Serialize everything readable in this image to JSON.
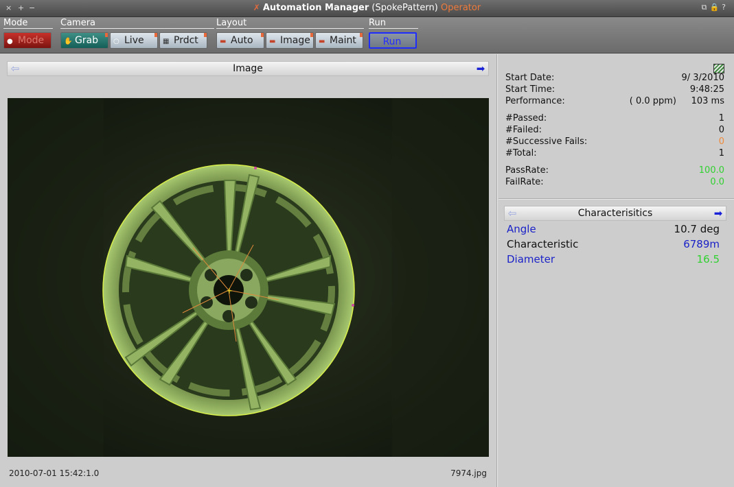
{
  "window": {
    "controls": [
      "×",
      "+",
      "−"
    ],
    "title_app": "Automation Manager",
    "title_project": "(SpokePattern)",
    "title_role": "Operator",
    "title_right_icons": [
      "⧉",
      "🔒",
      "?"
    ]
  },
  "toolbar": {
    "mode": {
      "label": "Mode",
      "buttons": [
        {
          "label": "Mode",
          "icon": "record-icon"
        }
      ]
    },
    "camera": {
      "label": "Camera",
      "buttons": [
        {
          "label": "Grab",
          "icon": "hand-icon"
        },
        {
          "label": "Live",
          "icon": "circle-icon"
        },
        {
          "label": "Prdct",
          "icon": "product-icon"
        }
      ]
    },
    "layout": {
      "label": "Layout",
      "buttons": [
        {
          "label": "Auto",
          "icon": "layout-icon"
        },
        {
          "label": "Image",
          "icon": "layout-icon"
        },
        {
          "label": "Maint",
          "icon": "layout-icon"
        }
      ]
    },
    "run": {
      "label": "Run",
      "buttons": [
        {
          "label": "Run"
        }
      ]
    }
  },
  "image_panel": {
    "title": "Image",
    "timestamp": "2010-07-01 15:42:1.0",
    "filename": "7974.jpg"
  },
  "stats": {
    "start_date_label": "Start Date:",
    "start_date": "9/ 3/2010",
    "start_time_label": "Start Time:",
    "start_time": "9:48:25",
    "performance_label": "Performance:",
    "performance_ppm": "(  0.0 ppm)",
    "performance_ms": "103 ms",
    "passed_label": "#Passed:",
    "passed": "1",
    "failed_label": "#Failed:",
    "failed": "0",
    "successive_label": "#Successive Fails:",
    "successive": "0",
    "total_label": "#Total:",
    "total": "1",
    "passrate_label": "PassRate:",
    "passrate": "100.0",
    "failrate_label": "FailRate:",
    "failrate": "0.0"
  },
  "characteristics": {
    "title": "Characterisitics",
    "rows": [
      {
        "label": "Angle",
        "value": "10.7 deg"
      },
      {
        "label": "Characteristic",
        "value": "6789m"
      },
      {
        "label": "Diameter",
        "value": "16.5"
      }
    ]
  },
  "colors": {
    "orange": "#f08a3a",
    "green": "#2fd12f",
    "blue": "#1a22c8",
    "wheel_tint": "#8fb55e",
    "overlay_circle": "#d9f04a",
    "spoke_lines": "#e08a3a"
  }
}
